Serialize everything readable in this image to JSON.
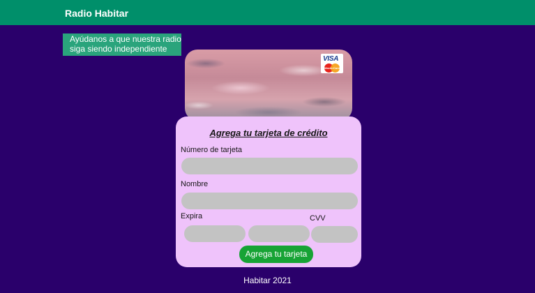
{
  "header": {
    "brand": "Radio Habitar"
  },
  "banner": {
    "line1": "Ayúdanos a que nuestra radio",
    "line2": "siga siendo independiente"
  },
  "hero": {
    "card_logos": [
      "VISA",
      "MasterCard"
    ]
  },
  "form": {
    "title": "Agrega tu tarjeta de crédito",
    "card_number_label": "Número de tarjeta",
    "card_number_value": "",
    "name_label": "Nombre",
    "name_value": "",
    "expiry_label": "Expira",
    "expiry_month_value": "",
    "expiry_year_value": "",
    "cvv_label": "CVV",
    "cvv_value": "",
    "submit_label": "Agrega tu tarjeta"
  },
  "footer": {
    "text": "Habitar 2021"
  },
  "colors": {
    "background": "#2a006b",
    "topbar": "#008f6a",
    "banner": "#2aa47c",
    "form_card": "#efc3fb",
    "input": "#c3c3c3",
    "submit": "#17a335"
  }
}
